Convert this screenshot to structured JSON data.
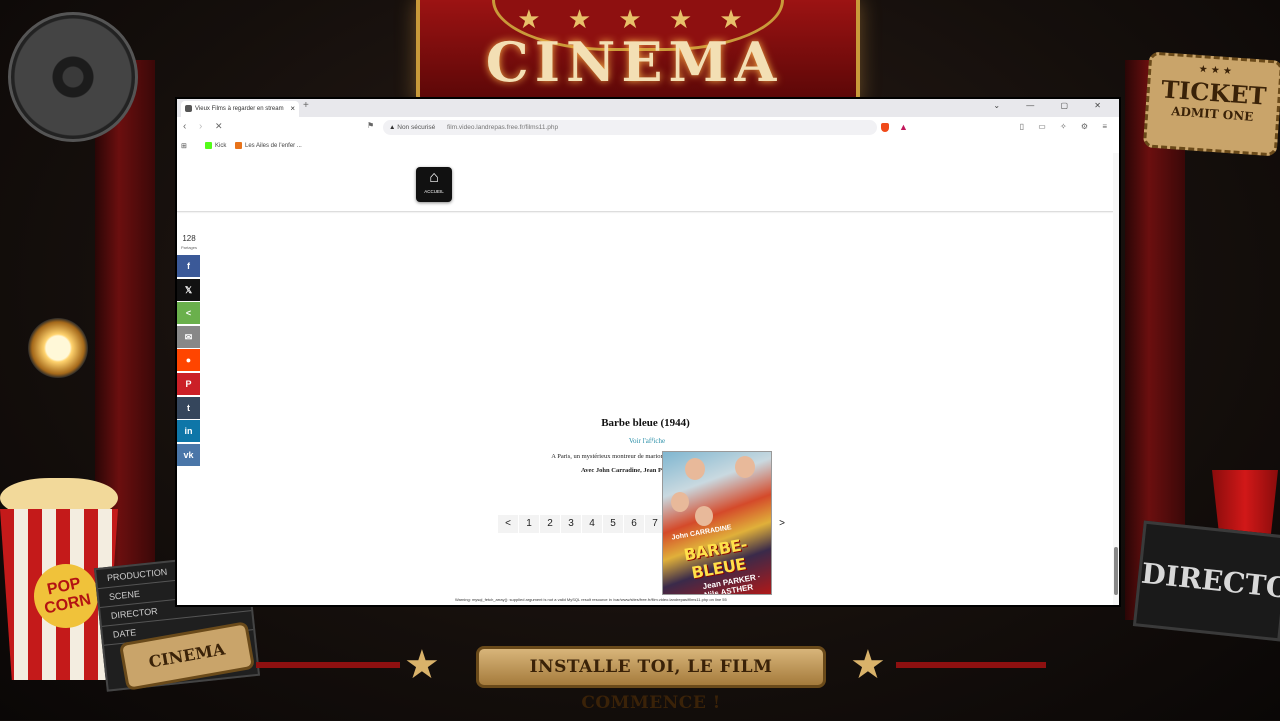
{
  "frame": {
    "marquee_title": "CINEMA",
    "marquee_stars": "★ ★ ★ ★ ★",
    "ticket_line1": "TICKET",
    "ticket_line2": "ADMIT ONE",
    "ticket_stars": "★ ★ ★",
    "popcorn_label": "POP CORN",
    "clapper_lines": [
      "PRODUCTION",
      "SCENE",
      "DIRECTOR",
      "DATE"
    ],
    "cinema_badge": "CINEMA",
    "director_label": "DIRECTOR",
    "bottom_banner": "INSTALLE TOI, LE FILM COMMENCE !"
  },
  "browser": {
    "tab_title": "Vieux Films à regarder en stream",
    "tab_close": "×",
    "new_tab": "+",
    "window_controls": "⌄ — ▢ ✕",
    "security_label": "Non sécurisé",
    "url": "film.video.landrepas.free.fr/films11.php",
    "bookmarks": [
      {
        "label": "Kick",
        "color": "#53fc18"
      },
      {
        "label": "Les Ailes de l'enfer ...",
        "color": "#e8731a"
      }
    ]
  },
  "page": {
    "home_label": "ACCUEIL",
    "share_count": "128",
    "share_sub": "Partages",
    "share_buttons": [
      {
        "name": "facebook",
        "glyph": "f",
        "color": "#3b5998"
      },
      {
        "name": "x",
        "glyph": "𝕏",
        "color": "#111111"
      },
      {
        "name": "share",
        "glyph": "<",
        "color": "#6ab04c"
      },
      {
        "name": "email",
        "glyph": "✉",
        "color": "#888888"
      },
      {
        "name": "reddit",
        "glyph": "●",
        "color": "#ff4500"
      },
      {
        "name": "pinterest",
        "glyph": "P",
        "color": "#cb2027"
      },
      {
        "name": "tumblr",
        "glyph": "t",
        "color": "#35465c"
      },
      {
        "name": "linkedin",
        "glyph": "in",
        "color": "#0e76a8"
      },
      {
        "name": "vk",
        "glyph": "vk",
        "color": "#4a76a8"
      }
    ],
    "film_title": "Barbe bleue (1944)",
    "voir_affiche": "Voir l'affiche",
    "synopsis": "A Paris, un mystérieux montreur de marionn",
    "cast": "Avec John Carradine, Jean P",
    "pagination_prev": "<",
    "pagination_pages": [
      "1",
      "2",
      "3",
      "4",
      "5",
      "6",
      "7"
    ],
    "pagination_next": ">",
    "poster": {
      "title": "BARBE-BLEUE",
      "actors_top": "John CARRADINE",
      "actors_bottom": "Jean PARKER · Nils ASTHER"
    },
    "warning_text": "Warning: mysql_fetch_array(): supplied argument is not a valid MySQL result resource in /var/www/sites/free.fr/film.video.landrepas/films11.php on line 55"
  }
}
